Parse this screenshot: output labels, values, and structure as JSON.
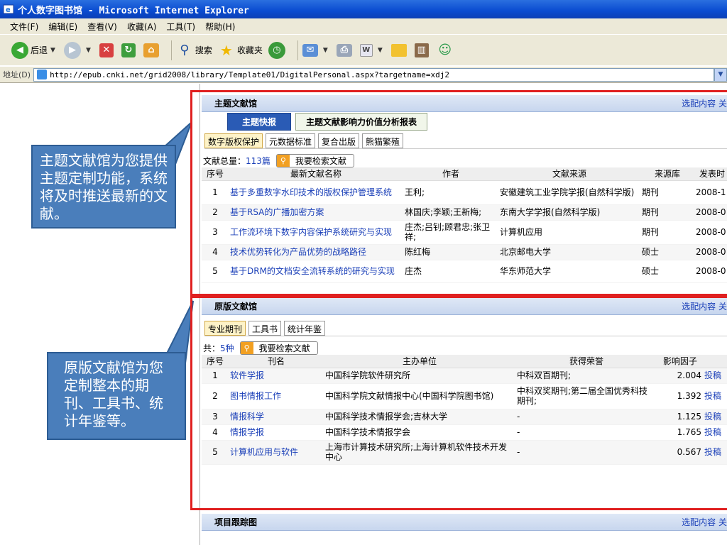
{
  "window": {
    "title": "个人数字图书馆 - Microsoft Internet Explorer"
  },
  "menu": [
    "文件(F)",
    "编辑(E)",
    "查看(V)",
    "收藏(A)",
    "工具(T)",
    "帮助(H)"
  ],
  "toolbar": {
    "back": "后退",
    "search": "搜索",
    "favorites": "收藏夹"
  },
  "address": {
    "label": "地址(D)",
    "url": "http://epub.cnki.net/grid2008/library/Template01/DigitalPersonal.aspx?targetname=xdj2"
  },
  "callouts": {
    "theme": "主题文献馆为您提供主题定制功能，系统将及时推送最新的文献。",
    "original": "原版文献馆为您定制整本的期刊、工具书、统计年鉴等。"
  },
  "theme_panel": {
    "title": "主题文献馆",
    "more": "选配内容 关",
    "tabs": [
      "主题快报",
      "主题文献影响力价值分析报表"
    ],
    "subtabs": [
      "数字版权保护",
      "元数据标准",
      "复合出版",
      "熊猫繁殖"
    ],
    "total_label": "文献总量：",
    "total_value": "113篇",
    "search_btn": "我要检索文献",
    "columns": [
      "序号",
      "最新文献名称",
      "作者",
      "文献来源",
      "来源库",
      "发表时"
    ],
    "rows": [
      {
        "no": "1",
        "title": "基于多重数字水印技术的版权保护管理系统",
        "author": "王利;",
        "source": "安徽建筑工业学院学报(自然科学版)",
        "db": "期刊",
        "date": "2008-1"
      },
      {
        "no": "2",
        "title": "基于RSA的广播加密方案",
        "author": "林国庆;李颖;王新梅;",
        "source": "东南大学学报(自然科学版)",
        "db": "期刊",
        "date": "2008-0"
      },
      {
        "no": "3",
        "title": "工作流环境下数字内容保护系统研究与实现",
        "author": "庄杰;吕钊;顾君忠;张卫祥;",
        "source": "计算机应用",
        "db": "期刊",
        "date": "2008-0"
      },
      {
        "no": "4",
        "title": "技术优势转化为产品优势的战略路径",
        "author": "陈红梅",
        "source": "北京邮电大学",
        "db": "硕士",
        "date": "2008-0"
      },
      {
        "no": "5",
        "title": "基于DRM的文档安全流转系统的研究与实现",
        "author": "庄杰",
        "source": "华东师范大学",
        "db": "硕士",
        "date": "2008-0"
      }
    ]
  },
  "original_panel": {
    "title": "原版文献馆",
    "more": "选配内容 关",
    "subtabs": [
      "专业期刊",
      "工具书",
      "统计年鉴"
    ],
    "total_label": "共：",
    "total_value": "5种",
    "search_btn": "我要检索文献",
    "columns": [
      "序号",
      "刊名",
      "主办单位",
      "获得荣誉",
      "影响因子",
      ""
    ],
    "rows": [
      {
        "no": "1",
        "name": "软件学报",
        "org": "中国科学院软件研究所",
        "honor": "中科双百期刊;",
        "factor": "2.004",
        "action": "投稿"
      },
      {
        "no": "2",
        "name": "图书情报工作",
        "org": "中国科学院文献情报中心(中国科学院图书馆)",
        "honor": "中科双奖期刊;第二届全国优秀科技期刊;",
        "factor": "1.392",
        "action": "投稿"
      },
      {
        "no": "3",
        "name": "情报科学",
        "org": "中国科学技术情报学会;吉林大学",
        "honor": "-",
        "factor": "1.125",
        "action": "投稿"
      },
      {
        "no": "4",
        "name": "情报学报",
        "org": "中国科学技术情报学会",
        "honor": "-",
        "factor": "1.765",
        "action": "投稿"
      },
      {
        "no": "5",
        "name": "计算机应用与软件",
        "org": "上海市计算技术研究所;上海计算机软件技术开发中心",
        "honor": "-",
        "factor": "0.567",
        "action": "投稿"
      }
    ]
  },
  "project_panel": {
    "title": "项目跟踪图",
    "more": "选配内容 关"
  }
}
